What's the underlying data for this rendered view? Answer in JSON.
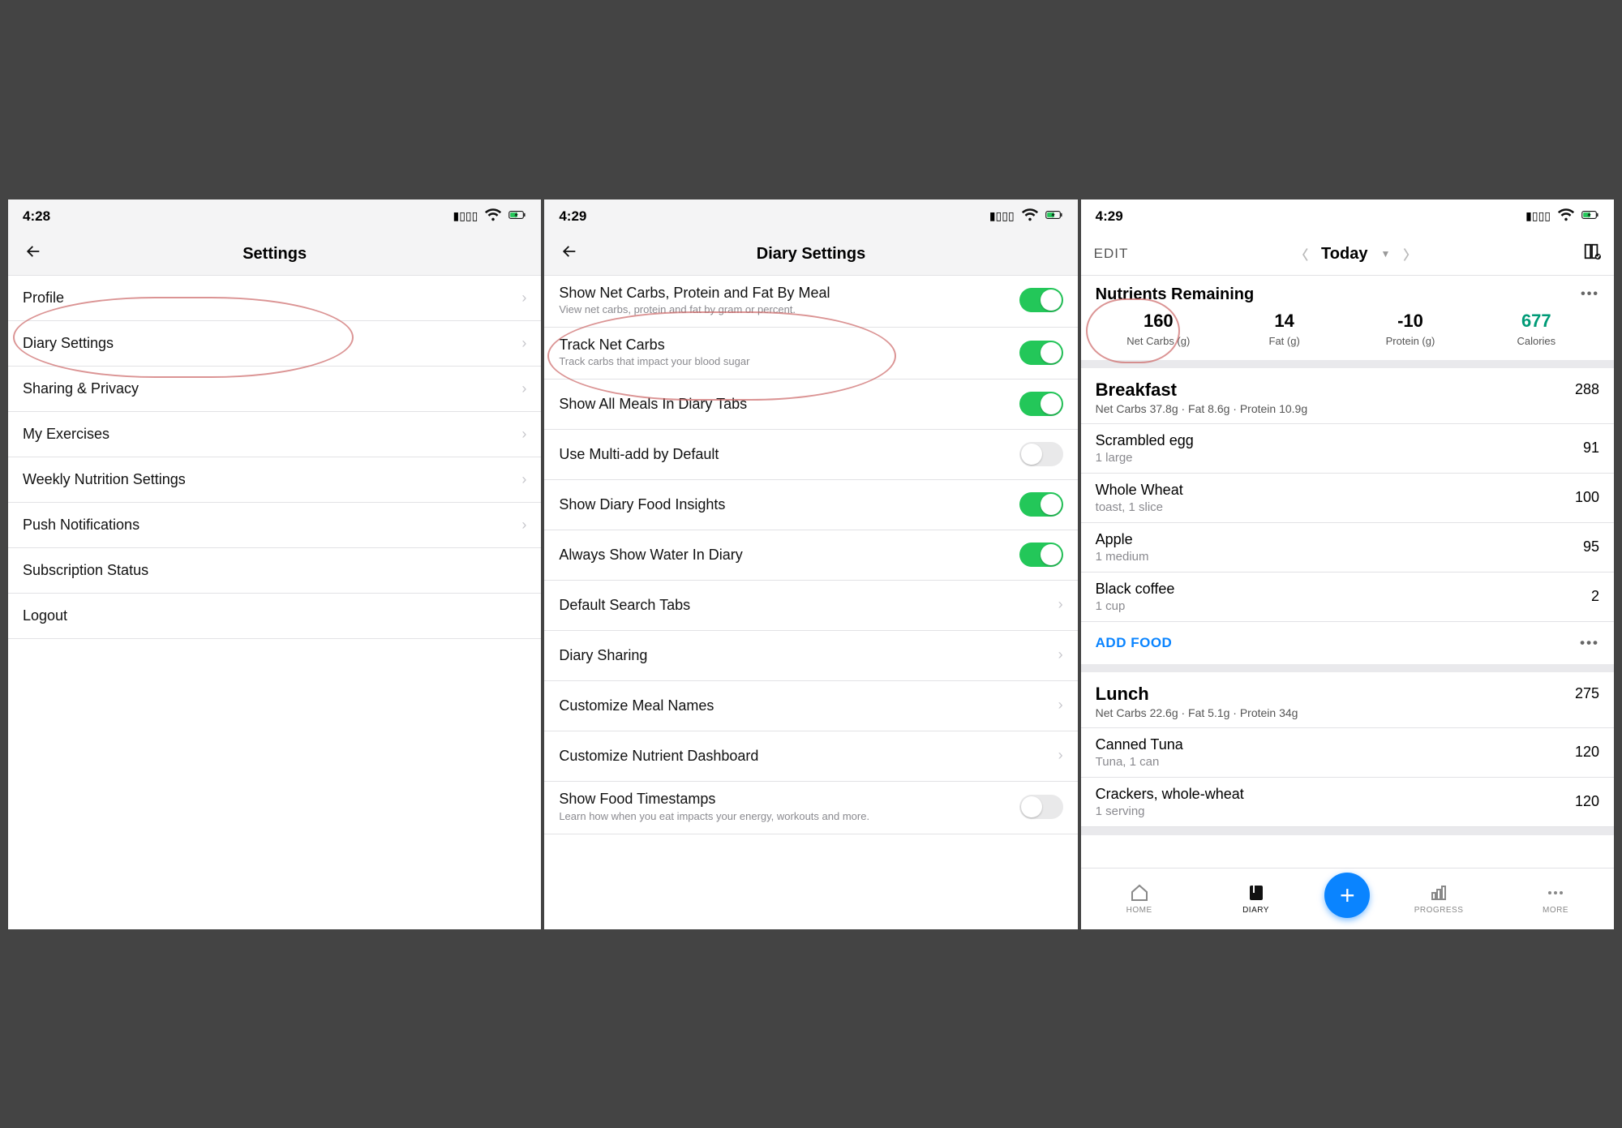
{
  "screen1": {
    "time": "4:28",
    "title": "Settings",
    "items": [
      {
        "label": "Profile",
        "chev": true
      },
      {
        "label": "Diary Settings",
        "chev": true
      },
      {
        "label": "Sharing & Privacy",
        "chev": true
      },
      {
        "label": "My Exercises",
        "chev": true
      },
      {
        "label": "Weekly Nutrition Settings",
        "chev": true
      },
      {
        "label": "Push Notifications",
        "chev": true
      },
      {
        "label": "Subscription Status",
        "chev": false
      },
      {
        "label": "Logout",
        "chev": false
      }
    ]
  },
  "screen2": {
    "time": "4:29",
    "title": "Diary Settings",
    "items": [
      {
        "label": "Show Net Carbs, Protein and Fat By Meal",
        "sub": "View net carbs, protein and fat by gram or percent.",
        "toggle": true,
        "on": true
      },
      {
        "label": "Track Net Carbs",
        "sub": "Track carbs that impact your blood sugar",
        "toggle": true,
        "on": true
      },
      {
        "label": "Show All Meals In Diary Tabs",
        "toggle": true,
        "on": true
      },
      {
        "label": "Use Multi-add by Default",
        "toggle": true,
        "on": false
      },
      {
        "label": "Show Diary Food Insights",
        "toggle": true,
        "on": true
      },
      {
        "label": "Always Show Water In Diary",
        "toggle": true,
        "on": true
      },
      {
        "label": "Default Search Tabs",
        "nav": true
      },
      {
        "label": "Diary Sharing",
        "nav": true
      },
      {
        "label": "Customize Meal Names",
        "nav": true
      },
      {
        "label": "Customize Nutrient Dashboard",
        "nav": true
      },
      {
        "label": "Show Food Timestamps",
        "sub": "Learn how when you eat impacts your energy, workouts and more.",
        "toggle": true,
        "on": false
      }
    ]
  },
  "screen3": {
    "time": "4:29",
    "edit": "EDIT",
    "date_label": "Today",
    "nutrients_title": "Nutrients Remaining",
    "nutrients": [
      {
        "val": "160",
        "lab": "Net Carbs (g)",
        "cal": false
      },
      {
        "val": "14",
        "lab": "Fat (g)",
        "cal": false
      },
      {
        "val": "-10",
        "lab": "Protein (g)",
        "cal": false
      },
      {
        "val": "677",
        "lab": "Calories",
        "cal": true
      }
    ],
    "meals": [
      {
        "name": "Breakfast",
        "cals": "288",
        "sub": "Net Carbs 37.8g · Fat 8.6g · Protein 10.9g",
        "foods": [
          {
            "name": "Scrambled egg",
            "serv": "1 large",
            "cals": "91"
          },
          {
            "name": "Whole Wheat",
            "serv": "toast, 1 slice",
            "cals": "100"
          },
          {
            "name": "Apple",
            "serv": "1 medium",
            "cals": "95"
          },
          {
            "name": "Black coffee",
            "serv": "1 cup",
            "cals": "2"
          }
        ],
        "add_label": "ADD FOOD",
        "show_add": true
      },
      {
        "name": "Lunch",
        "cals": "275",
        "sub": "Net Carbs 22.6g · Fat 5.1g · Protein 34g",
        "foods": [
          {
            "name": "Canned Tuna",
            "serv": "Tuna, 1 can",
            "cals": "120"
          },
          {
            "name": "Crackers, whole-wheat",
            "serv": "1 serving",
            "cals": "120"
          }
        ],
        "show_add": false
      }
    ],
    "tabs": [
      {
        "label": "HOME",
        "active": false,
        "icon": "home"
      },
      {
        "label": "DIARY",
        "active": true,
        "icon": "book"
      },
      {
        "label": "",
        "fab": true
      },
      {
        "label": "PROGRESS",
        "active": false,
        "icon": "bars"
      },
      {
        "label": "MORE",
        "active": false,
        "icon": "dots"
      }
    ]
  }
}
